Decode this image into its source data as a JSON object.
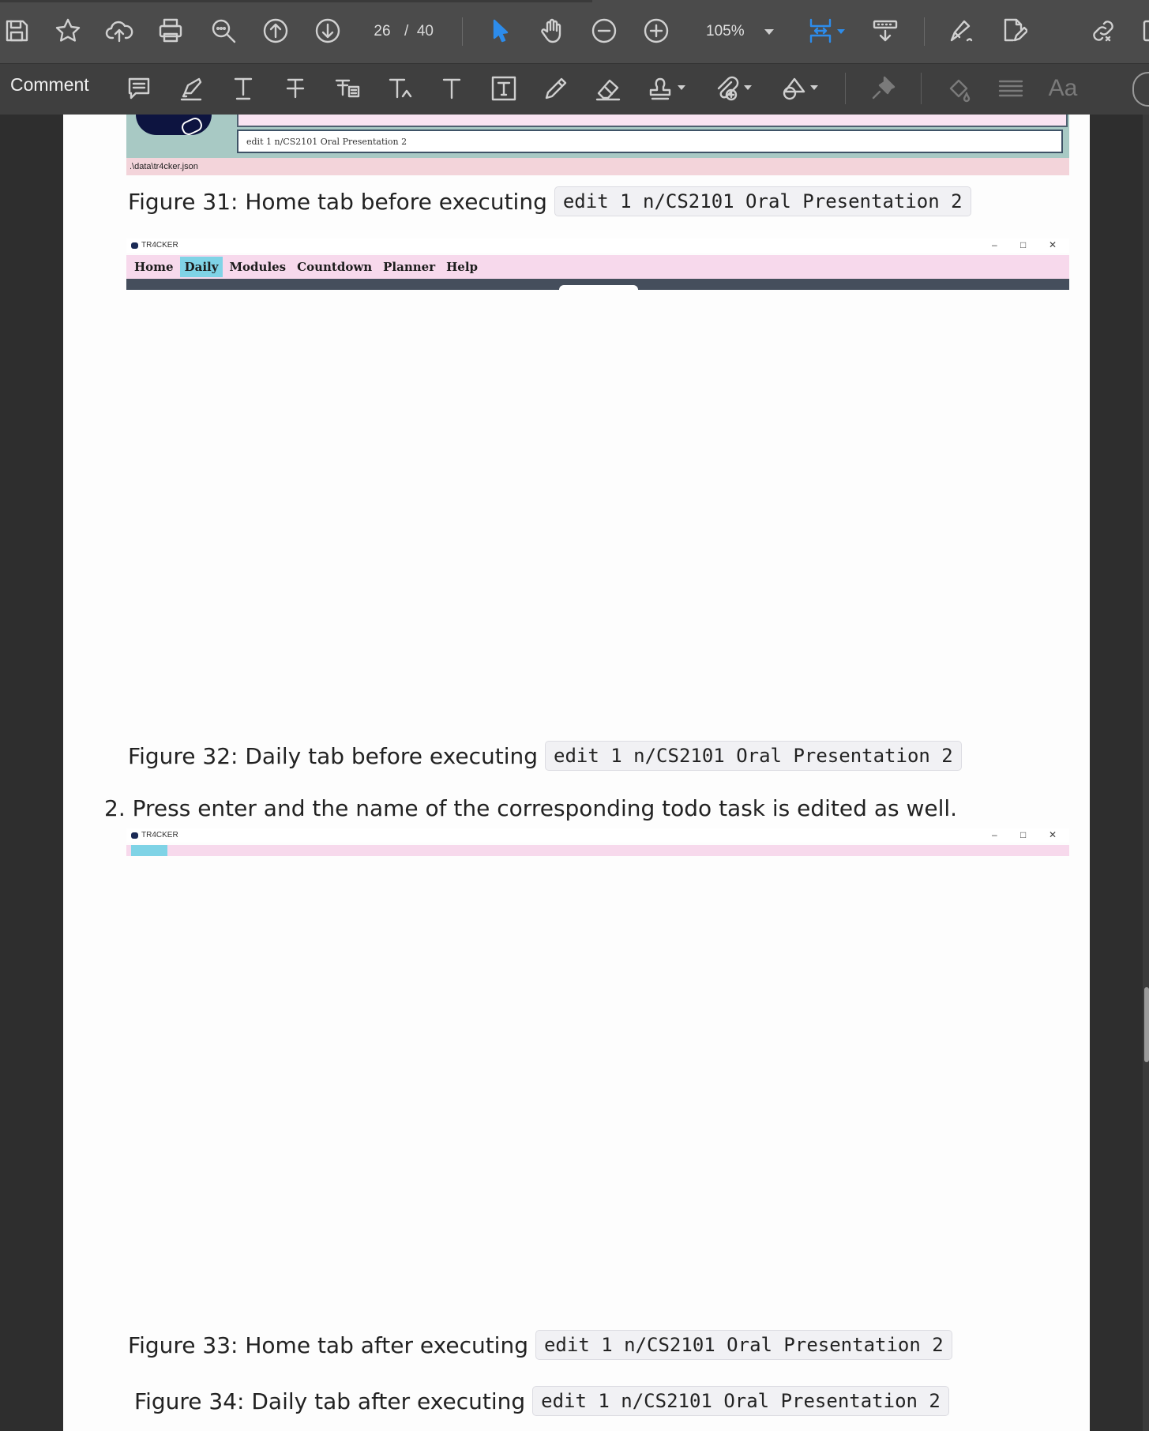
{
  "toolbar": {
    "page_current": "26",
    "page_separator": "/",
    "page_total": "40",
    "zoom": "105%",
    "icons": [
      "save-icon",
      "star-icon",
      "cloud-upload-icon",
      "print-icon",
      "search-icon",
      "page-up-icon",
      "page-down-icon",
      "select-pointer-icon",
      "hand-icon",
      "zoom-out-icon",
      "zoom-in-icon",
      "fit-page-icon",
      "scroll-mode-icon",
      "sign-icon",
      "edit-pdf-icon",
      "link-icon"
    ],
    "accent": "#2d8ceb"
  },
  "comment_toolbar": {
    "label": "Comment",
    "icons": [
      "sticky-note-icon",
      "highlight-icon",
      "underline-icon",
      "strikethrough-icon",
      "replace-text-icon",
      "insert-text-icon",
      "add-text-icon",
      "text-box-icon",
      "pencil-icon",
      "eraser-icon",
      "stamp-icon",
      "attach-icon",
      "shapes-icon",
      "pin-icon",
      "fill-icon",
      "lines-icon",
      "font-icon"
    ]
  },
  "document": {
    "top_screenshot": {
      "input_text": "edit 1 n/CS2101 Oral Presentation 2",
      "status_path": ".\\data\\tr4cker.json"
    },
    "fig31": {
      "prefix": "Figure 31: Home tab before executing",
      "code": "edit 1 n/CS2101 Oral Presentation 2"
    },
    "app_window_1": {
      "title": "TR4CKER",
      "menu": [
        "Home",
        "Daily",
        "Modules",
        "Countdown",
        "Planner",
        "Help"
      ],
      "selected": "Daily"
    },
    "fig32": {
      "prefix": "Figure 32: Daily tab before executing",
      "code": "edit 1 n/CS2101 Oral Presentation 2"
    },
    "list_item": "2. Press enter and the name of the corresponding todo task is edited as well.",
    "app_window_2": {
      "title": "TR4CKER"
    },
    "fig33": {
      "prefix": "Figure 33: Home tab after executing",
      "code": "edit 1 n/CS2101 Oral Presentation 2"
    },
    "fig34": {
      "prefix": "Figure 34: Daily tab after executing",
      "code": "edit 1 n/CS2101 Oral Presentation 2"
    }
  }
}
